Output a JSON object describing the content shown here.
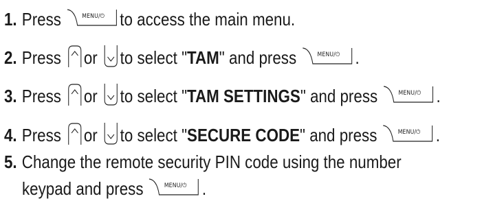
{
  "keys": {
    "menu_label": "MENU/⏻"
  },
  "steps": [
    {
      "number": "1.",
      "parts": [
        "Press",
        "to access the main menu."
      ]
    },
    {
      "number": "2.",
      "parts": [
        "Press",
        "or",
        "to select \"",
        "TAM",
        "\" and press",
        "."
      ]
    },
    {
      "number": "3.",
      "parts": [
        "Press",
        "or",
        "to select \"",
        "TAM SETTINGS",
        "\" and press",
        "."
      ]
    },
    {
      "number": "4.",
      "parts": [
        "Press",
        "or",
        "to select \"",
        "SECURE CODE",
        "\" and press",
        "."
      ]
    },
    {
      "number": "5.",
      "parts": [
        "Change the remote security PIN code using the number",
        "keypad and press",
        "."
      ]
    }
  ]
}
